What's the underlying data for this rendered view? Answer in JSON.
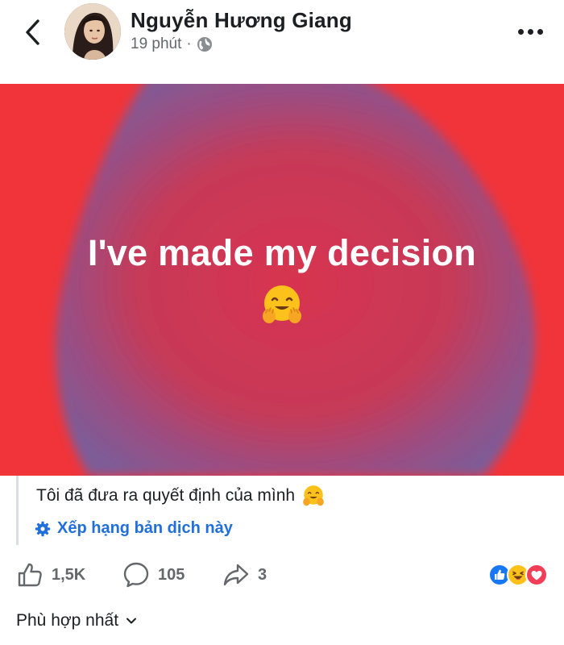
{
  "post": {
    "author_name": "Nguyễn Hương Giang",
    "time": "19 phút",
    "separator": "·",
    "privacy_icon": "globe-icon",
    "image_text": "I've made my decision",
    "image_colors": {
      "background": "#f0343a",
      "blob": "#8a5a8e"
    }
  },
  "translation": {
    "text": "Tôi đã đưa ra quyết định của mình",
    "rate_label": "Xếp hạng bản dịch này"
  },
  "actions": {
    "likes": "1,5K",
    "comments": "105",
    "shares": "3"
  },
  "reactions": [
    "like",
    "haha",
    "love"
  ],
  "sort": {
    "label": "Phù hợp nhất"
  },
  "colors": {
    "accent": "#216fdb",
    "muted": "#65676b",
    "text": "#1c1e21"
  }
}
